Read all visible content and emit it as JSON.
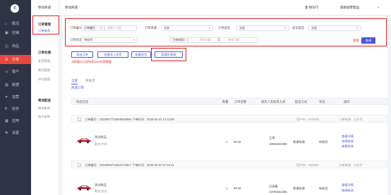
{
  "sidebar": {
    "logo": "¢",
    "items": [
      {
        "label": "概况",
        "icon": "⌂"
      },
      {
        "label": "店铺",
        "icon": "▣"
      },
      {
        "label": "商品",
        "icon": "◫"
      },
      {
        "label": "订单",
        "icon": "☰"
      },
      {
        "label": "客户",
        "icon": "☺"
      },
      {
        "label": "数据",
        "icon": "▥"
      },
      {
        "label": "运营",
        "icon": "✦"
      },
      {
        "label": "财务",
        "icon": "¥"
      },
      {
        "label": "应用",
        "icon": "▦"
      },
      {
        "label": "设置",
        "icon": "⚙"
      }
    ]
  },
  "subnav": {
    "header": "移动商城",
    "g1": "订单管理",
    "g1_items": [
      "订单查询"
    ],
    "g2": "订单处理",
    "g2_items": [
      "发货管理",
      "售后管理",
      "评价管理"
    ],
    "g3": "物流配送",
    "g3_items": [
      "物流查询",
      "电子面单"
    ]
  },
  "topbar": {
    "crumb": "移动商城",
    "right1": "金 杨军行",
    "right2": "跑跑城零售品"
  },
  "filters": {
    "order_no_label": "订单编号",
    "order_no_value": "订单编号",
    "order_no_placeholder": "请输入内容",
    "source_label": "订单来源",
    "source_value": "全部",
    "type_label": "订单类型",
    "type_value": "全部",
    "ship_type_label": "发货类型",
    "ship_type_value": "全部",
    "status_label": "订单状态",
    "status_value": "待发货",
    "time_type": "下单时间",
    "start_date": "开始日期",
    "date_sep": "至",
    "end_date": "结束日期",
    "reset": "重置",
    "query": "查询"
  },
  "actions": {
    "export": "导出订单",
    "batch_import": "批量导入发货",
    "batch_ship": "批量发货",
    "batch_logistics": "批量补物流",
    "link1": "导出记录",
    "tip": "当前展示已支持导出1000条数据"
  },
  "tabs": {
    "items": [
      "全部",
      "待发货"
    ],
    "sub": "商城订单"
  },
  "table": {
    "headers": [
      "商品信息",
      "数量",
      "订单金额",
      "收货人及联系方式",
      "配送方式",
      "状态",
      "操作"
    ]
  },
  "orders": [
    {
      "id_line": "订单编号：D333917732849694656 下单时间：2020-02-24 12:13:55",
      "user_line": "用户ID：E3392I0",
      "shop_line": "订单来源：公众号",
      "product": "测试商品",
      "spec": "款式:大众",
      "qty": "1",
      "amount": "¥0.02",
      "receiver": "王琦",
      "phone": "18566322369",
      "ship": "普通快递",
      "status": "待收货",
      "ops": [
        "查看详情",
        "修改物流",
        "查看物流"
      ]
    },
    {
      "id_line": "订单编号：D333909734354774917 下单时间：2020-02-22 07:15:41",
      "user_line": "用户ID：H33I0I4",
      "shop_line": "订单来源：公众号",
      "product": "测试商品",
      "spec": "款式:大众",
      "qty": "1",
      "amount": "¥0.02",
      "receiver": "记录童",
      "phone": "13792331365",
      "ship": "普通快递",
      "status": "待收货",
      "ops": [
        "查看详情",
        "修改物流"
      ]
    }
  ],
  "colors": {
    "accent": "#4a57d8",
    "danger": "#e02020",
    "sidebar": "#2f3345",
    "active": "#e8473e"
  }
}
